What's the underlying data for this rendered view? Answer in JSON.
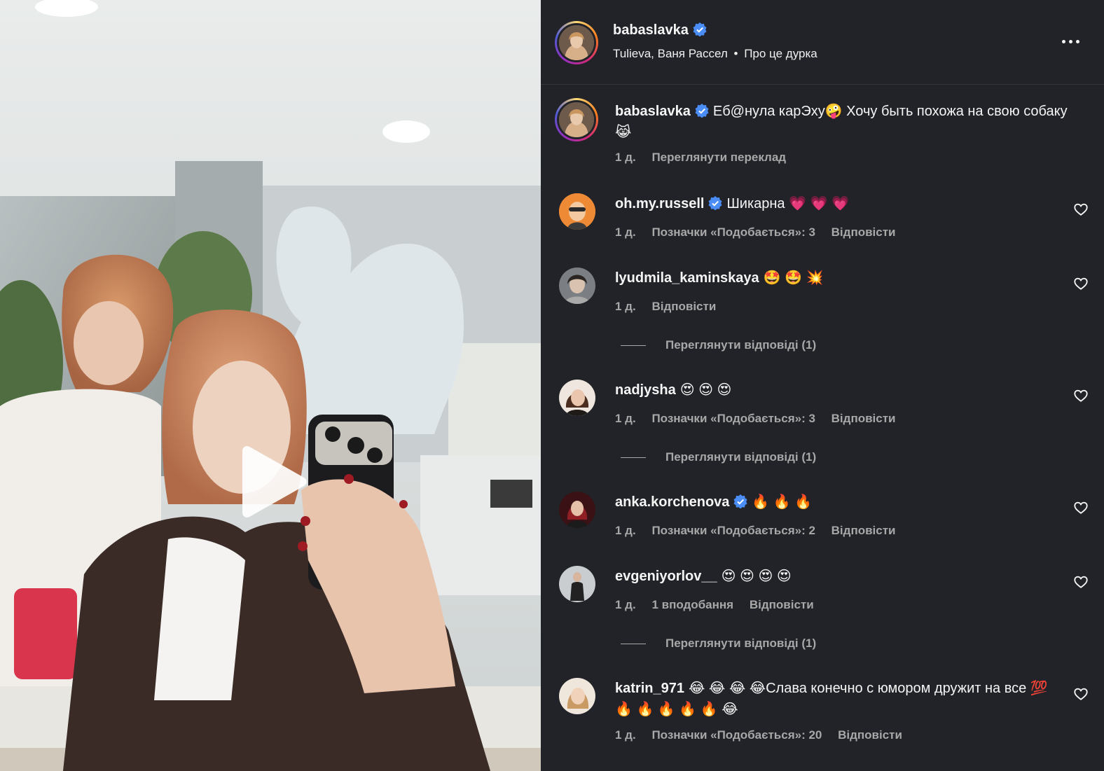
{
  "post": {
    "author": "babaslavka",
    "verified": true,
    "audio_line": "Tulieva, Ваня Рассел",
    "audio_title": "Про це дурка",
    "media_type": "video"
  },
  "caption": {
    "username": "babaslavka",
    "text": "Еб@нула карЭху🤪 Хочу быть похожа на свою собаку 😹",
    "time": "1 д.",
    "translate_label": "Переглянути переклад"
  },
  "comments": [
    {
      "username": "oh.my.russell",
      "verified": true,
      "text": "Шикарна 💗 💗 💗",
      "time": "1 д.",
      "likes": "Позначки «Подобається»: 3",
      "reply": "Відповісти",
      "view_replies": ""
    },
    {
      "username": "lyudmila_kaminskaya",
      "verified": false,
      "text": "🤩 🤩 💥",
      "time": "1 д.",
      "likes": "",
      "reply": "Відповісти",
      "view_replies": "Переглянути відповіді (1)"
    },
    {
      "username": "nadjysha",
      "verified": false,
      "text": "😍 😍 😍",
      "time": "1 д.",
      "likes": "Позначки «Подобається»: 3",
      "reply": "Відповісти",
      "view_replies": "Переглянути відповіді (1)"
    },
    {
      "username": "anka.korchenova",
      "verified": true,
      "text": "🔥 🔥 🔥",
      "time": "1 д.",
      "likes": "Позначки «Подобається»: 2",
      "reply": "Відповісти",
      "view_replies": ""
    },
    {
      "username": "evgeniyorlov__",
      "verified": false,
      "text": "😍 😍 😍 😍",
      "time": "1 д.",
      "likes": "1 вподобання",
      "reply": "Відповісти",
      "view_replies": "Переглянути відповіді (1)"
    },
    {
      "username": "katrin_971",
      "verified": false,
      "text": "😂 😂 😂 😂Слава конечно с юмором дружит на все 💯 🔥 🔥 🔥 🔥 🔥 😂",
      "time": "1 д.",
      "likes": "Позначки «Подобається»: 20",
      "reply": "Відповісти",
      "view_replies": ""
    }
  ],
  "colors": {
    "panel_bg": "#212328",
    "text": "#f5f5f5",
    "muted": "#a8a8a8",
    "verified": "#4a8df6"
  }
}
